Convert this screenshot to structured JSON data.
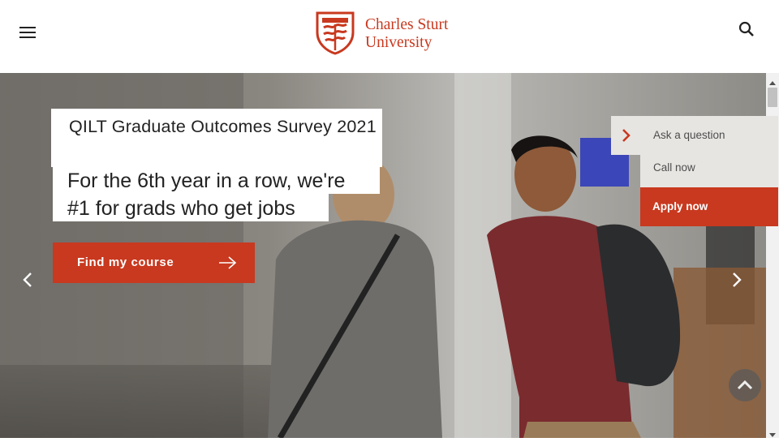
{
  "header": {
    "menu_icon": "hamburger-menu-icon",
    "logo_line1": "Charles Sturt",
    "logo_line2": "University",
    "search_icon": "search-icon"
  },
  "hero": {
    "survey_title": "QILT Graduate Outcomes Survey 2021",
    "claim_line1": "For the 6th year in a row, we're",
    "claim_line2": "#1 for grads who get jobs",
    "cta_label": "Find my course",
    "prev_icon": "chevron-left-icon",
    "next_icon": "chevron-right-icon"
  },
  "side_widget": {
    "toggle_icon": "chevron-right-icon",
    "ask": "Ask a question",
    "call": "Call now",
    "apply": "Apply now"
  },
  "back_to_top_icon": "chevron-up-icon",
  "colors": {
    "brand": "#c8391f",
    "widget_bg": "#e7e5e2",
    "text": "#222222"
  }
}
